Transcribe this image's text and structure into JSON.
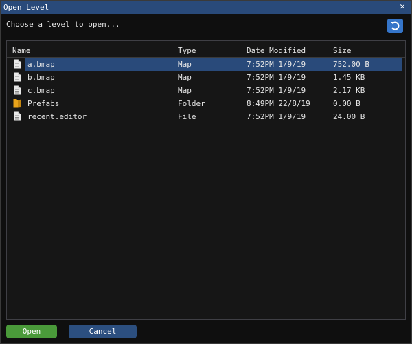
{
  "window": {
    "title": "Open Level",
    "close_glyph": "✕"
  },
  "prompt": "Choose a level to open...",
  "refresh_icon": "refresh-icon",
  "columns": {
    "name": "Name",
    "type": "Type",
    "date": "Date Modified",
    "size": "Size"
  },
  "files": [
    {
      "name": "a.bmap",
      "type": "Map",
      "date": "7:52PM 1/9/19",
      "size": "752.00 B",
      "icon": "file-icon",
      "selected": true
    },
    {
      "name": "b.bmap",
      "type": "Map",
      "date": "7:52PM 1/9/19",
      "size": "1.45 KB",
      "icon": "file-icon",
      "selected": false
    },
    {
      "name": "c.bmap",
      "type": "Map",
      "date": "7:52PM 1/9/19",
      "size": "2.17 KB",
      "icon": "file-icon",
      "selected": false
    },
    {
      "name": "Prefabs",
      "type": "Folder",
      "date": "8:49PM 22/8/19",
      "size": "0.00 B",
      "icon": "folder-icon",
      "selected": false
    },
    {
      "name": "recent.editor",
      "type": "File",
      "date": "7:52PM 1/9/19",
      "size": "24.00 B",
      "icon": "file-icon",
      "selected": false
    }
  ],
  "buttons": {
    "open": "Open",
    "cancel": "Cancel"
  },
  "colors": {
    "titlebar": "#294a7a",
    "selection": "#294a7a",
    "open_button": "#4a9a3a",
    "cancel_button": "#2c4f7f",
    "refresh_button": "#3575c9",
    "folder_icon": "#e8a31a"
  }
}
